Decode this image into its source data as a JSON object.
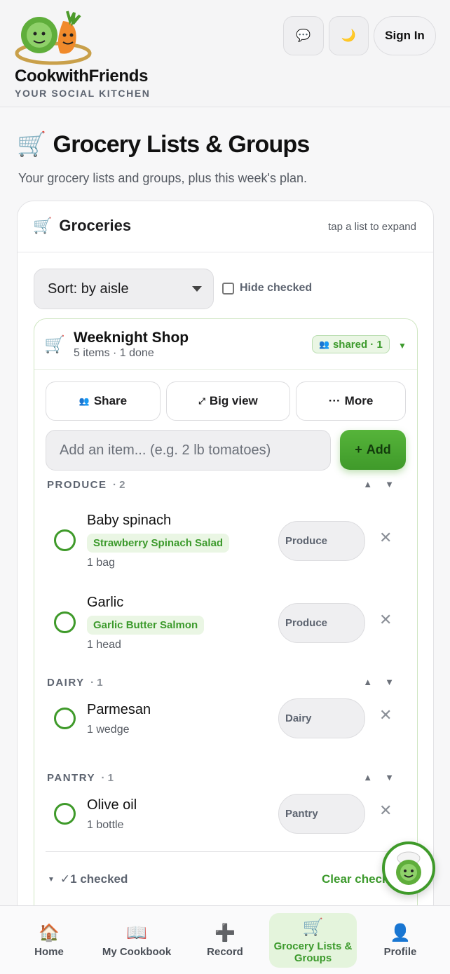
{
  "header": {
    "brand_name": "CookwithFriends",
    "brand_tagline": "YOUR SOCIAL KITCHEN",
    "chat_icon": "💬",
    "moon_icon": "🌙",
    "sign_in_label": "Sign In"
  },
  "page": {
    "title_icon": "🛒",
    "title": "Grocery Lists & Groups",
    "subtitle": "Your grocery lists and groups, plus this week's plan."
  },
  "card": {
    "title_icon": "🛒",
    "title": "Groceries",
    "hint": "tap a list to expand",
    "sort_value": "Sort: by aisle",
    "hide_checked_label": "Hide checked"
  },
  "list": {
    "cart_icon": "🛒",
    "name": "Weeknight Shop",
    "meta": "5 items · 1 done",
    "shared_icon": "👥",
    "shared_label": "shared · 1",
    "toggle_icon": "▼",
    "actions": {
      "share_icon": "👥",
      "share_label": "Share",
      "big_icon": "⤢",
      "big_label": "Big view",
      "more_icon": "···",
      "more_label": "More"
    },
    "add_placeholder": "Add an item... (e.g. 2 lb tomatoes)",
    "add_button_icon": "+",
    "add_button_label": "Add",
    "sections": [
      {
        "label": "PRODUCE",
        "count": "· 2",
        "items": [
          {
            "name": "Baby spinach",
            "recipe": "Strawberry Spinach Salad",
            "qty": "1 bag",
            "aisle": "Produce"
          },
          {
            "name": "Garlic",
            "recipe": "Garlic Butter Salmon",
            "qty": "1 head",
            "aisle": "Produce"
          }
        ]
      },
      {
        "label": "DAIRY",
        "count": "· 1",
        "items": [
          {
            "name": "Parmesan",
            "qty": "1 wedge",
            "aisle": "Dairy"
          }
        ]
      },
      {
        "label": "PANTRY",
        "count": "· 1",
        "items": [
          {
            "name": "Olive oil",
            "qty": "1 bottle",
            "aisle": "Pantry"
          }
        ]
      }
    ],
    "checked_summary": "✓1 checked",
    "clear_checked_label": "Clear check"
  },
  "nav": [
    {
      "icon": "🏠",
      "label": "Home"
    },
    {
      "icon": "📖",
      "label": "My Cookbook"
    },
    {
      "icon": "➕",
      "label": "Record"
    },
    {
      "icon": "🛒",
      "label": "Grocery Lists & Groups"
    },
    {
      "icon": "👤",
      "label": "Profile"
    }
  ],
  "colors": {
    "accent": "#3f9a2a",
    "accent_light": "#eaf6e4",
    "background": "#f7f7f8"
  }
}
